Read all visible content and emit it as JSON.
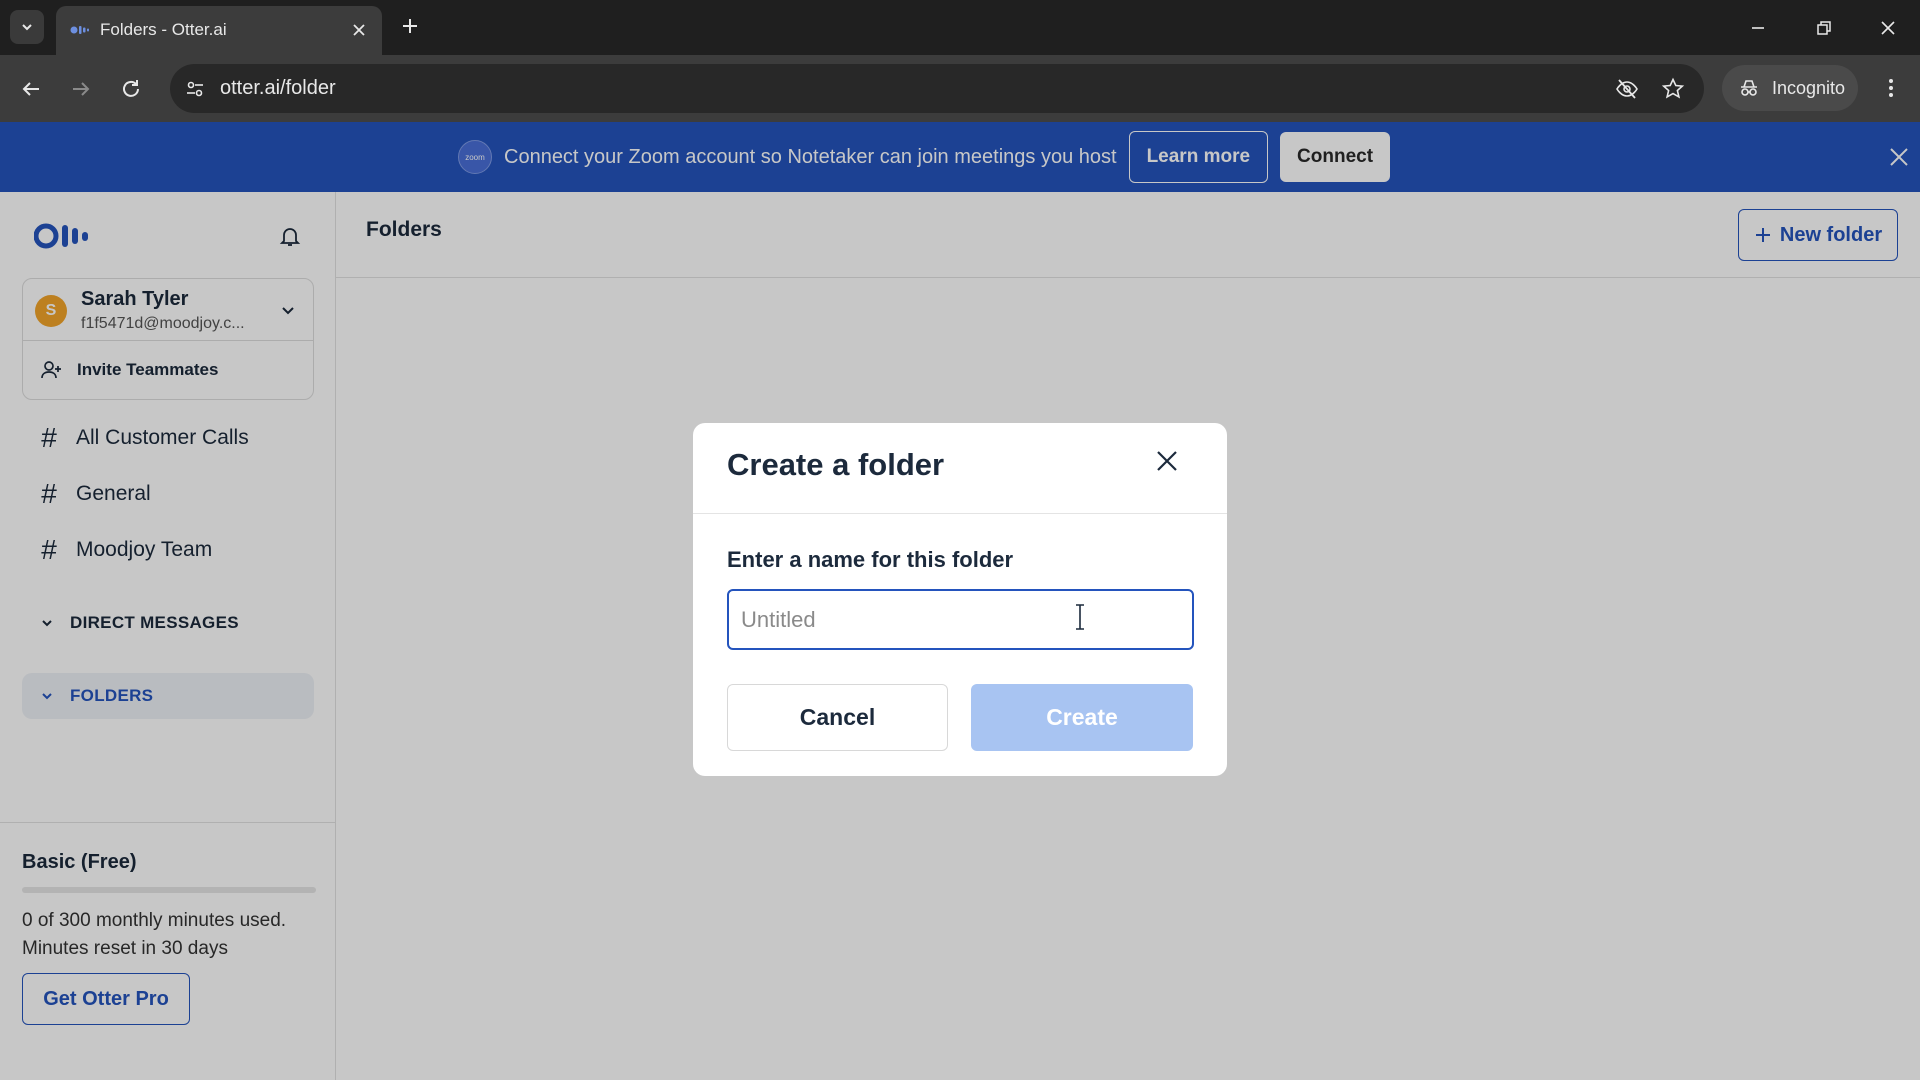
{
  "browser": {
    "tab_title": "Folders - Otter.ai",
    "url": "otter.ai/folder",
    "incognito_label": "Incognito"
  },
  "banner": {
    "zoom_logo_text": "zoom",
    "message": "Connect your Zoom account so Notetaker can join meetings you host",
    "learn_more": "Learn more",
    "connect": "Connect"
  },
  "sidebar": {
    "user": {
      "initial": "S",
      "name": "Sarah Tyler",
      "email": "f1f5471d@moodjoy.c..."
    },
    "invite": "Invite Teammates",
    "channels": [
      {
        "label": "All Customer Calls"
      },
      {
        "label": "General"
      },
      {
        "label": "Moodjoy Team"
      }
    ],
    "sections": {
      "direct_messages": "DIRECT MESSAGES",
      "folders": "FOLDERS"
    },
    "plan": {
      "name": "Basic (Free)",
      "usage_line1": "0 of 300 monthly minutes used.",
      "usage_line2": "Minutes reset in 30 days",
      "usage_fraction": 0,
      "cta": "Get Otter Pro"
    }
  },
  "main": {
    "title": "Folders",
    "new_folder": "New folder"
  },
  "modal": {
    "title": "Create a folder",
    "field_label": "Enter a name for this folder",
    "input_value": "",
    "input_placeholder": "Untitled",
    "cancel": "Cancel",
    "create": "Create"
  },
  "colors": {
    "brand_blue": "#2454bd",
    "create_disabled": "#a8c4f2",
    "avatar": "#f2a52a"
  }
}
